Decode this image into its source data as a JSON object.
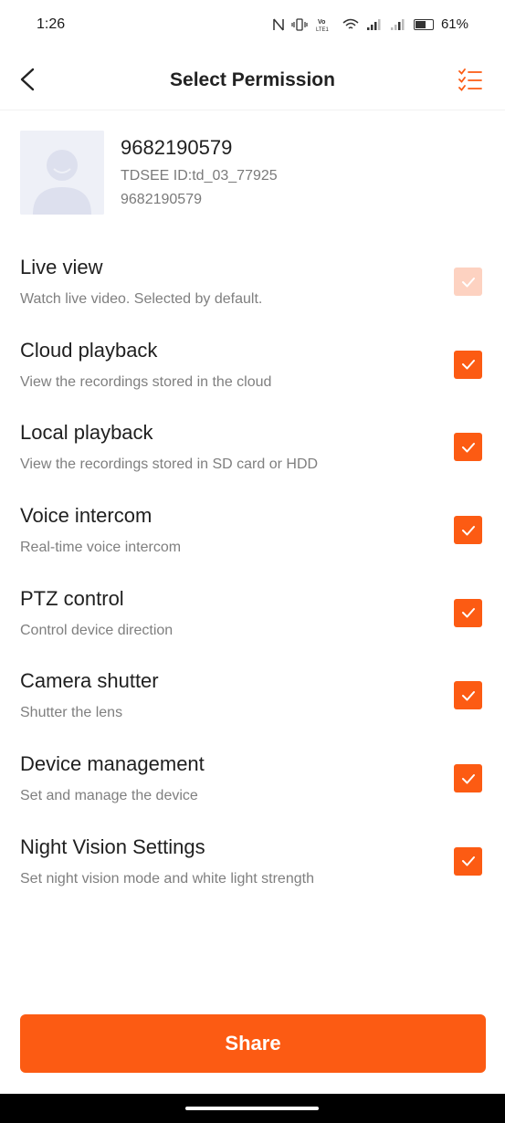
{
  "status_bar": {
    "time": "1:26",
    "battery_percent": "61%",
    "icons": [
      "nfc-icon",
      "vibrate-icon",
      "volte-icon",
      "wifi-icon",
      "signal-icon",
      "signal-icon-2",
      "battery-icon"
    ],
    "volte_label": "Vo LTE1"
  },
  "header": {
    "title": "Select Permission",
    "back_icon": "chevron-left-icon",
    "action_icon": "checklist-icon"
  },
  "user": {
    "name": "9682190579",
    "tdsee_id": "TDSEE ID:td_03_77925",
    "phone": "9682190579",
    "avatar_icon": "person-avatar-icon"
  },
  "permissions": [
    {
      "title": "Live view",
      "desc": "Watch live video. Selected by default.",
      "checked": true,
      "disabled": true
    },
    {
      "title": "Cloud playback",
      "desc": "View the recordings stored in the cloud",
      "checked": true,
      "disabled": false
    },
    {
      "title": "Local playback",
      "desc": "View the recordings stored in SD card or HDD",
      "checked": true,
      "disabled": false
    },
    {
      "title": "Voice intercom",
      "desc": "Real-time voice intercom",
      "checked": true,
      "disabled": false
    },
    {
      "title": "PTZ control",
      "desc": "Control device direction",
      "checked": true,
      "disabled": false
    },
    {
      "title": "Camera shutter",
      "desc": "Shutter the lens",
      "checked": true,
      "disabled": false
    },
    {
      "title": "Device management",
      "desc": "Set and manage the device",
      "checked": true,
      "disabled": false
    },
    {
      "title": "Night Vision Settings",
      "desc": "Set night vision mode and white light strength",
      "checked": true,
      "disabled": false
    }
  ],
  "share_button": {
    "label": "Share"
  },
  "colors": {
    "accent": "#fc5b13",
    "accent_disabled": "#fdd2c1"
  }
}
